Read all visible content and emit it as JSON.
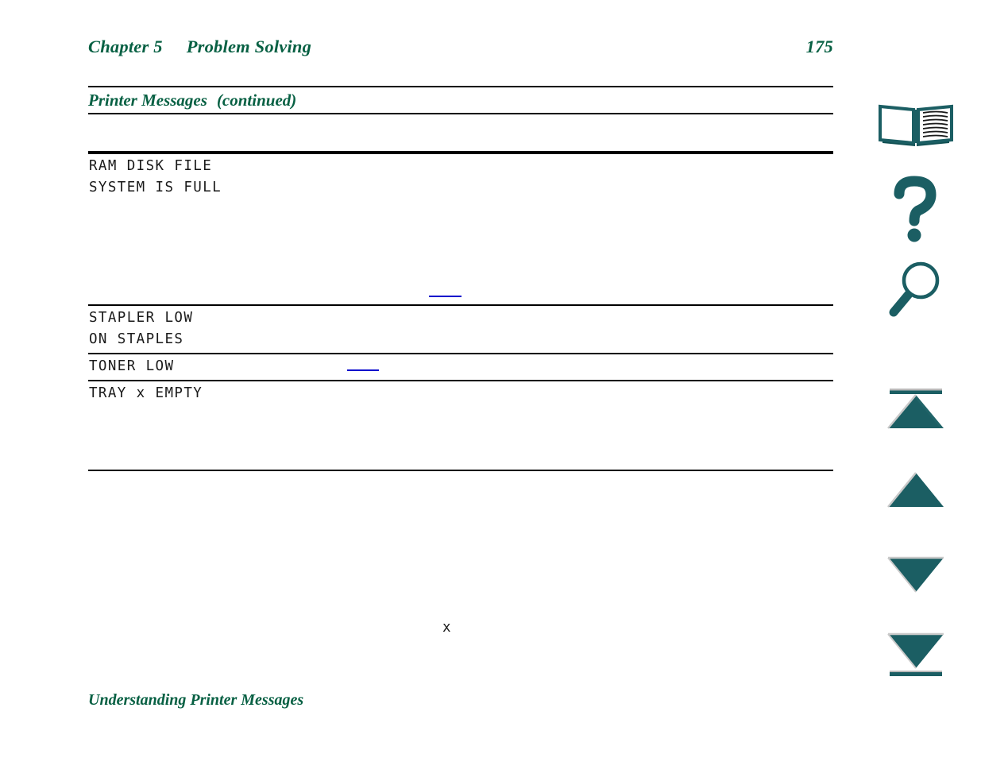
{
  "document": {
    "running_head": {
      "chapter": "Chapter 5",
      "title": "Problem Solving",
      "page_number": "175"
    },
    "section": {
      "title": "Printer Messages",
      "continued": "(continued)"
    },
    "footer": "Understanding Printer Messages",
    "table": {
      "rows": [
        {
          "message": "RAM DISK FILE\nSYSTEM IS FULL",
          "description": "",
          "action": ""
        },
        {
          "message": "STAPLER LOW\nON STAPLES",
          "description": "",
          "action": ""
        },
        {
          "message": "TONER LOW",
          "description": "",
          "action": ""
        },
        {
          "message": "TRAY x EMPTY",
          "description": "",
          "action": "x"
        }
      ]
    }
  },
  "nav_rail": {
    "buttons": [
      {
        "name": "book-icon",
        "label": "Contents"
      },
      {
        "name": "question-mark-icon",
        "label": "Help"
      },
      {
        "name": "magnifier-icon",
        "label": "Search"
      },
      {
        "name": "triangle-up-bar-icon",
        "label": "First Page"
      },
      {
        "name": "triangle-up-icon",
        "label": "Previous Page"
      },
      {
        "name": "triangle-down-icon",
        "label": "Next Page"
      },
      {
        "name": "triangle-down-bar-icon",
        "label": "Last Page"
      }
    ]
  },
  "colors": {
    "heading_green": "#076043",
    "icon_teal": "#1b5e63",
    "link_blue": "#0000cc",
    "rule_black": "#000000"
  }
}
